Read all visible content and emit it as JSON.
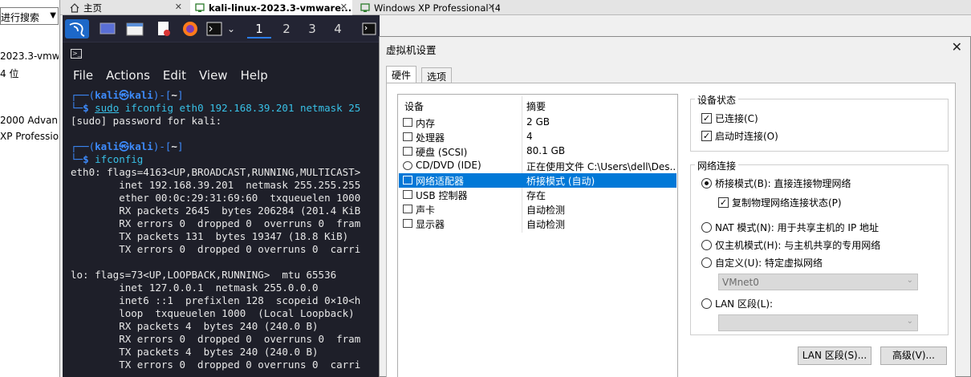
{
  "tabs": [
    {
      "label": "主页"
    },
    {
      "label": "kali-linux-2023.3-vmware..."
    },
    {
      "label": "Windows XP Professional (4)"
    }
  ],
  "sidebar": {
    "search_text": "进行搜索",
    "items": [
      "2023.3-vmw",
      "4 位",
      "2000 Advan",
      "XP Professio"
    ]
  },
  "kali": {
    "workspaces": [
      "1",
      "2",
      "3",
      "4"
    ],
    "menu": [
      "File",
      "Actions",
      "Edit",
      "View",
      "Help"
    ],
    "terminal": {
      "prompt_open": "┌──(",
      "prompt_user": "kali",
      "prompt_at": "㉿",
      "prompt_host": "kali",
      "prompt_close": ")-[",
      "prompt_path": "~",
      "prompt_end": "]",
      "prompt_line2": "└─",
      "prompt_dollar": "$ ",
      "cmd1_sudo": "sudo",
      "cmd1_rest": " ifconfig eth0 192.168.39.201 netmask 25",
      "out1": "[sudo] password for kali:",
      "cmd2": "ifconfig",
      "lines": [
        "eth0: flags=4163<UP,BROADCAST,RUNNING,MULTICAST>",
        "        inet 192.168.39.201  netmask 255.255.255",
        "        ether 00:0c:29:31:69:60  txqueuelen 1000",
        "        RX packets 2645  bytes 206284 (201.4 KiB",
        "        RX errors 0  dropped 0  overruns 0  fram",
        "        TX packets 131  bytes 19347 (18.8 KiB)",
        "        TX errors 0  dropped 0 overruns 0  carri",
        "",
        "lo: flags=73<UP,LOOPBACK,RUNNING>  mtu 65536",
        "        inet 127.0.0.1  netmask 255.0.0.0",
        "        inet6 ::1  prefixlen 128  scopeid 0×10<h",
        "        loop  txqueuelen 1000  (Local Loopback)",
        "        RX packets 4  bytes 240 (240.0 B)",
        "        RX errors 0  dropped 0  overruns 0  fram",
        "        TX packets 4  bytes 240 (240.0 B)",
        "        TX errors 0  dropped 0 overruns 0  carri"
      ]
    }
  },
  "dialog": {
    "title": "虚拟机设置",
    "tabs": [
      "硬件",
      "选项"
    ],
    "list_headers": {
      "device": "设备",
      "summary": "摘要"
    },
    "devices": [
      {
        "name": "内存",
        "summary": "2 GB",
        "icon": "memory-icon"
      },
      {
        "name": "处理器",
        "summary": "4",
        "icon": "cpu-icon"
      },
      {
        "name": "硬盘 (SCSI)",
        "summary": "80.1 GB",
        "icon": "harddisk-icon"
      },
      {
        "name": "CD/DVD (IDE)",
        "summary": "正在使用文件 C:\\Users\\dell\\Des...",
        "icon": "cdrom-icon"
      },
      {
        "name": "网络适配器",
        "summary": "桥接模式 (自动)",
        "icon": "network-icon"
      },
      {
        "name": "USB 控制器",
        "summary": "存在",
        "icon": "usb-icon"
      },
      {
        "name": "声卡",
        "summary": "自动检测",
        "icon": "sound-icon"
      },
      {
        "name": "显示器",
        "summary": "自动检测",
        "icon": "display-icon"
      }
    ],
    "device_status": {
      "title": "设备状态",
      "connected": "已连接(C)",
      "connect_on_power": "启动时连接(O)"
    },
    "network": {
      "title": "网络连接",
      "bridged": "桥接模式(B): 直接连接物理网络",
      "replicate": "复制物理网络连接状态(P)",
      "nat": "NAT 模式(N): 用于共享主机的 IP 地址",
      "hostonly": "仅主机模式(H): 与主机共享的专用网络",
      "custom": "自定义(U): 特定虚拟网络",
      "custom_value": "VMnet0",
      "lan": "LAN 区段(L):",
      "lan_value": ""
    },
    "buttons": {
      "lan_segments": "LAN 区段(S)...",
      "advanced": "高级(V)..."
    }
  }
}
